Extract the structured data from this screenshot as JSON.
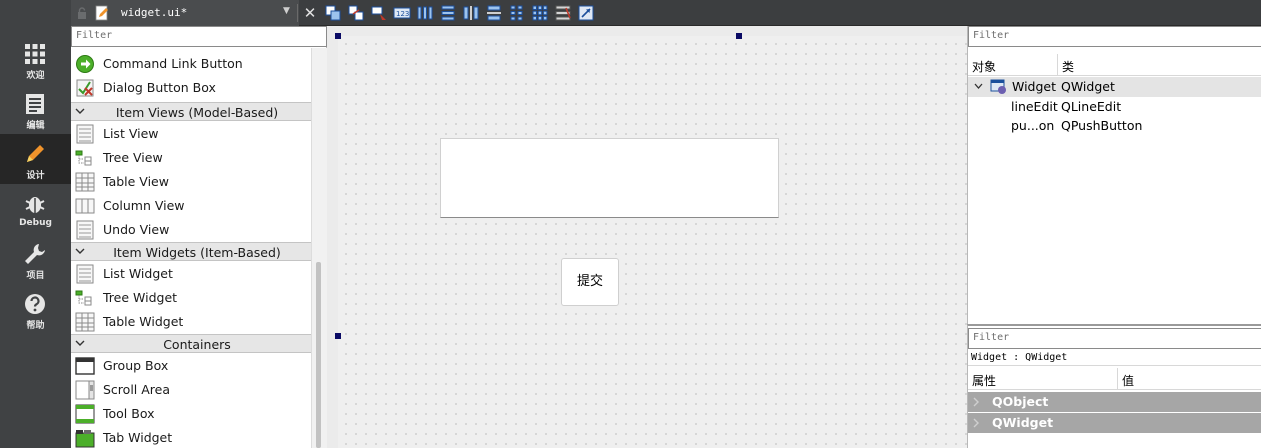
{
  "mode_bar": [
    {
      "label": "欢迎",
      "icon": "grid-icon"
    },
    {
      "label": "编辑",
      "icon": "document-icon"
    },
    {
      "label": "设计",
      "icon": "pencil-icon"
    },
    {
      "label": "Debug",
      "icon": "bug-icon"
    },
    {
      "label": "项目",
      "icon": "wrench-icon"
    },
    {
      "label": "帮助",
      "icon": "help-icon"
    }
  ],
  "toolbar": {
    "file_name": "widget.ui*",
    "close_symbol": "✕"
  },
  "widget_box": {
    "filter_placeholder": "Filter",
    "items": [
      {
        "kind": "item",
        "label": "Command Link Button",
        "icon": "command-link-icon"
      },
      {
        "kind": "item",
        "label": "Dialog Button Box",
        "icon": "dialog-button-box-icon"
      },
      {
        "kind": "category",
        "label": "Item Views (Model-Based)"
      },
      {
        "kind": "item",
        "label": "List View",
        "icon": "list-view-icon"
      },
      {
        "kind": "item",
        "label": "Tree View",
        "icon": "tree-view-icon"
      },
      {
        "kind": "item",
        "label": "Table View",
        "icon": "table-view-icon"
      },
      {
        "kind": "item",
        "label": "Column View",
        "icon": "column-view-icon"
      },
      {
        "kind": "item",
        "label": "Undo View",
        "icon": "undo-view-icon"
      },
      {
        "kind": "category",
        "label": "Item Widgets (Item-Based)"
      },
      {
        "kind": "item",
        "label": "List Widget",
        "icon": "list-widget-icon"
      },
      {
        "kind": "item",
        "label": "Tree Widget",
        "icon": "tree-widget-icon"
      },
      {
        "kind": "item",
        "label": "Table Widget",
        "icon": "table-widget-icon"
      },
      {
        "kind": "category",
        "label": "Containers"
      },
      {
        "kind": "item",
        "label": "Group Box",
        "icon": "group-box-icon"
      },
      {
        "kind": "item",
        "label": "Scroll Area",
        "icon": "scroll-area-icon"
      },
      {
        "kind": "item",
        "label": "Tool Box",
        "icon": "tool-box-icon"
      },
      {
        "kind": "item",
        "label": "Tab Widget",
        "icon": "tab-widget-icon"
      }
    ]
  },
  "form": {
    "push_button_text": "提交"
  },
  "object_inspector": {
    "filter_placeholder": "Filter",
    "col_object": "对象",
    "col_class": "类",
    "rows": [
      {
        "name": "Widget",
        "type": "QWidget",
        "selected": true
      },
      {
        "name": "lineEdit",
        "type": "QLineEdit",
        "selected": false
      },
      {
        "name": "pu...on",
        "type": "QPushButton",
        "selected": false
      }
    ]
  },
  "property_editor": {
    "filter_placeholder": "Filter",
    "title": "Widget : QWidget",
    "col_property": "属性",
    "col_value": "值",
    "groups": [
      "QObject",
      "QWidget"
    ]
  },
  "colors": {
    "modebar_bg": "#404244",
    "active_mode_bg": "#262626",
    "toolbar_bg": "#3c3e40",
    "group_header_bg": "#a6a6a6",
    "selection_handle": "#0a0a64"
  }
}
